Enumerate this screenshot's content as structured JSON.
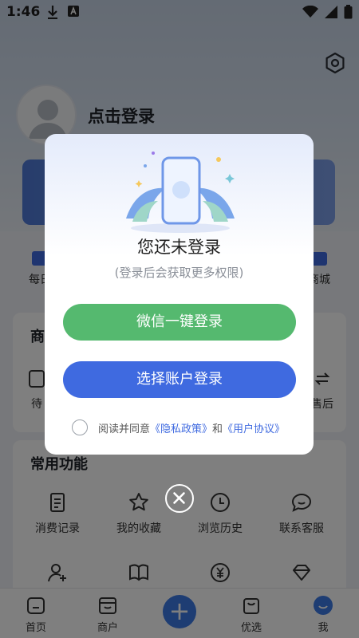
{
  "status_bar": {
    "time": "1:46"
  },
  "profile": {
    "login_prompt": "点击登录"
  },
  "quick_entries": [
    {
      "label": "每日",
      "icon": "calendar-icon"
    },
    {
      "label": "商城",
      "icon": "store-icon"
    }
  ],
  "orders_card": {
    "title": "商",
    "items": [
      {
        "label": "待",
        "icon": "wallet-icon"
      },
      {
        "label": "售后",
        "icon": "refund-icon"
      }
    ]
  },
  "common_functions": {
    "title": "常用功能",
    "items": [
      {
        "label": "消费记录",
        "icon": "document-icon"
      },
      {
        "label": "我的收藏",
        "icon": "star-icon"
      },
      {
        "label": "浏览历史",
        "icon": "clock-icon"
      },
      {
        "label": "联系客服",
        "icon": "chat-icon"
      }
    ],
    "second_row_icons": [
      "add-user-icon",
      "book-icon",
      "yuan-exchange-icon",
      "diamond-icon"
    ]
  },
  "tabbar": {
    "items": [
      {
        "label": "首页",
        "icon": "home-icon"
      },
      {
        "label": "商户",
        "icon": "shop-icon"
      },
      {
        "label": "优选",
        "icon": "bag-icon"
      },
      {
        "label": "我",
        "icon": "smile-icon"
      }
    ],
    "center_icon": "plus-icon"
  },
  "dialog": {
    "title": "您还未登录",
    "subtitle": "(登录后会获取更多权限)",
    "wechat_button": "微信一键登录",
    "account_button": "选择账户登录",
    "agreement_prefix": "阅读并同意",
    "privacy_link": "《隐私政策》",
    "agreement_and": "和",
    "user_agreement_link": "《用户协议》",
    "close_icon": "close-icon"
  },
  "colors": {
    "wechat_green": "#55b96f",
    "primary_blue": "#3f6ae0",
    "scrim": "rgba(0,0,0,0.5)"
  }
}
